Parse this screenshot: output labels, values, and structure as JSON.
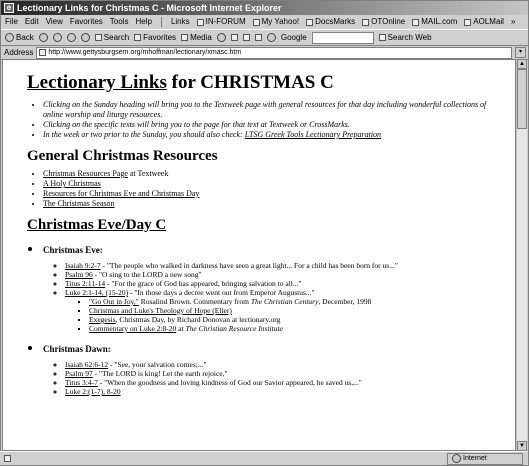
{
  "window": {
    "title": "Lectionary Links for Christmas C - Microsoft Internet Explorer"
  },
  "menu": {
    "items": [
      "File",
      "Edit",
      "View",
      "Favorites",
      "Tools",
      "Help"
    ],
    "links_label": "Links",
    "links": [
      "IN-FORUM",
      "My Yahoo!",
      "DocsMarks",
      "OTOnline",
      "MAIL.com",
      "AOLMail"
    ],
    "more": "»"
  },
  "toolbar": {
    "back": "Back",
    "search": "Search",
    "favorites": "Favorites",
    "media": "Media",
    "google_label": "Google",
    "search_web": "Search Web"
  },
  "address": {
    "label": "Address",
    "url": "http://www.gettysburgsem.org/mhoffman/lectionary/xmasc.htm"
  },
  "page": {
    "title_link": "Lectionary Links",
    "title_rest": " for CHRISTMAS C",
    "intro": [
      "Clicking on the Sunday heading will bring you to the Textweek page with general resources for that day including wonderful collections of online worship and liturgy resources.",
      "Clicking on the specific texts will bring you to the page for that text at Textweek or CrossMarks."
    ],
    "intro3_text": "In the week or two prior to the Sunday, you should also check: ",
    "intro3_link": "LTSG Greek Tools Lectionary Preparation",
    "general_heading": "General Christmas Resources",
    "res1_link": "Christmas Resources Page",
    "res1_text": " at Textweek",
    "res2_link": "A Holy Christmas",
    "res3_link": "Resources for Christmas Eve and Christmas Day",
    "res4_link": "The Christmas Season",
    "eve_heading": "Christmas Eve/Day C",
    "eve_label": "Christmas Eve:",
    "eve_r1_link": "Isaiah 9:2-7",
    "eve_r1_text": " - \"The people who walked in darkness have seen a great light... For a child has been born for us...\"",
    "eve_r2_link": "Psalm 96",
    "eve_r2_text": " - \"O sing to the LORD a new song\"",
    "eve_r3_link": "Titus 2:11-14",
    "eve_r3_text": " - \"For the grace of God has appeared, bringing salvation to all...\"",
    "eve_r4_link": "Luke 2:1-14, (15-20)",
    "eve_r4_text": " - \"In those days a decree went out from Emperor Augustus...\"",
    "sub1_link": "\"Go Out in Joy,\"",
    "sub1_text_a": " Rosalind Brown. Commentary from ",
    "sub1_em": "The Christian Century",
    "sub1_text_b": ", December, 1998",
    "sub2_link": "Christmas and Luke's Theology of Hope (Eller)",
    "sub3_link": "Exegesis",
    "sub3_text": ", Christmas Day, by Richard Donovan at lectionary.org",
    "sub4_link": "Commentary on Luke 2:8-20",
    "sub4_text": " at ",
    "sub4_em": "The Christian Resource Institute",
    "dawn_label": "Christmas Dawn:",
    "dawn_r1_link": "Isaiah 62:6-12",
    "dawn_r1_text": " - \"See, your salvation comes;...\"",
    "dawn_r2_link": "Psalm 97",
    "dawn_r2_text": " - \"The LORD is king! Let the earth rejoice,\"",
    "dawn_r3_link": "Titus 3:4-7",
    "dawn_r3_text": " - \"When the goodness and loving kindness of God our Savior appeared, he saved us,...\"",
    "dawn_r4_link": "Luke 2:(1-7), 8-20"
  },
  "status": {
    "zone": "Internet"
  }
}
